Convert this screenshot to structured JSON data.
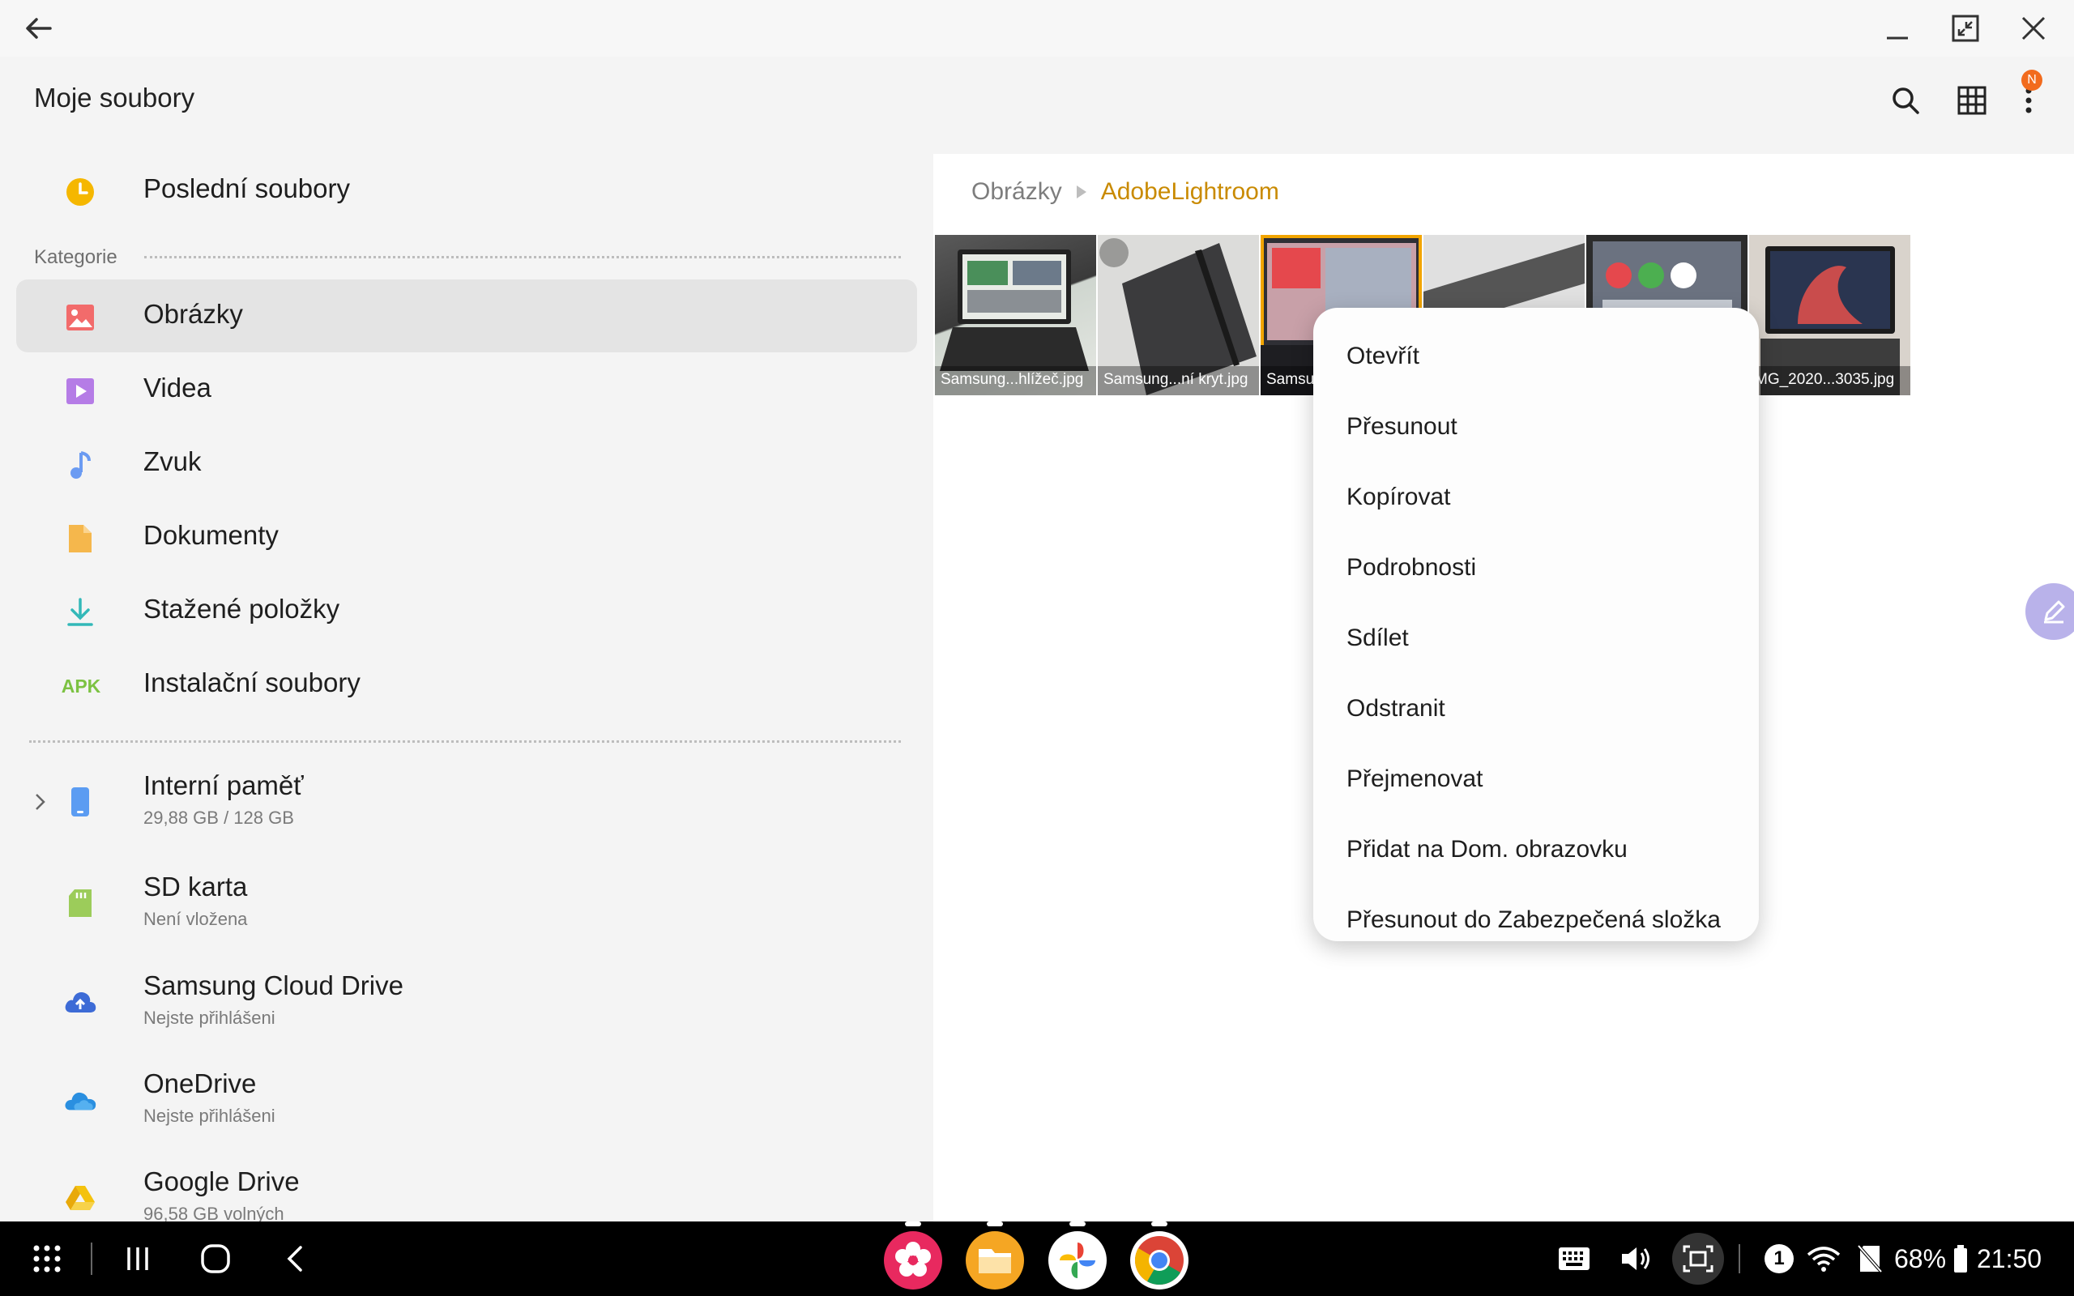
{
  "app": {
    "title": "Moje soubory",
    "notification_badge": "N"
  },
  "window_controls": {
    "back_icon": "arrow-left-icon",
    "minimize_icon": "minimize-icon",
    "restore_icon": "restore-icon",
    "close_icon": "close-icon"
  },
  "header_actions": {
    "search_icon": "search-icon",
    "view_icon": "grid-view-icon",
    "more_icon": "more-vert-icon"
  },
  "sidebar": {
    "recent": {
      "label": "Poslední soubory",
      "icon": "clock-icon",
      "color": "#f5b700"
    },
    "category_heading": "Kategorie",
    "categories": [
      {
        "label": "Obrázky",
        "icon": "image-icon",
        "color": "#f26b6b",
        "active": true
      },
      {
        "label": "Videa",
        "icon": "video-icon",
        "color": "#b57ce6"
      },
      {
        "label": "Zvuk",
        "icon": "music-icon",
        "color": "#6b9bf2"
      },
      {
        "label": "Dokumenty",
        "icon": "document-icon",
        "color": "#f5b74c"
      },
      {
        "label": "Stažené položky",
        "icon": "download-icon",
        "color": "#33b8b8"
      },
      {
        "label": "Instalační soubory",
        "icon": "apk-icon",
        "icon_text": "APK",
        "color": "#7cc242"
      }
    ],
    "storage": [
      {
        "label": "Interní paměť",
        "sub": "29,88 GB / 128 GB",
        "icon": "phone-icon",
        "color": "#5b9cf2",
        "expandable": true
      },
      {
        "label": "SD karta",
        "sub": "Není vložena",
        "icon": "sd-card-icon",
        "color": "#9ccc5a"
      },
      {
        "label": "Samsung Cloud Drive",
        "sub": "Nejste přihlášeni",
        "icon": "cloud-upload-icon",
        "color": "#3d6bd6"
      },
      {
        "label": "OneDrive",
        "sub": "Nejste přihlášeni",
        "icon": "onedrive-icon",
        "color": "#2a8fe0"
      },
      {
        "label": "Google Drive",
        "sub": "96,58 GB volných",
        "icon": "google-drive-icon",
        "color": "#f4c20d"
      }
    ]
  },
  "content": {
    "breadcrumb": {
      "parent": "Obrázky",
      "current": "AdobeLightroom"
    },
    "thumbnails": [
      {
        "caption": "Samsung...hlížeč.jpg",
        "bg1": "#3a3a3a",
        "bg2": "#cfd6cf"
      },
      {
        "caption": "Samsung...ní kryt.jpg",
        "bg1": "#3b3b3d",
        "bg2": "#d8d8d6"
      },
      {
        "caption": "Samsu",
        "bg1": "#2f2f35",
        "bg2": "#c8a0a8",
        "selected": true
      },
      {
        "caption": "",
        "bg1": "#555555",
        "bg2": "#e0e0e0"
      },
      {
        "caption": "",
        "bg1": "#2c2c2c",
        "bg2": "#6b7280"
      },
      {
        "caption": "MG_2020...3035.jpg",
        "bg1": "#3d3d3d",
        "bg2": "#c94c4c"
      }
    ]
  },
  "context_menu": {
    "items": [
      "Otevřít",
      "Přesunout",
      "Kopírovat",
      "Podrobnosti",
      "Sdílet",
      "Odstranit",
      "Přejmenovat",
      "Přidat na Dom. obrazovku",
      "Přesunout do Zabezpečená složka"
    ]
  },
  "floating": {
    "edit_icon": "pen-icon"
  },
  "taskbar": {
    "apps_icon": "app-drawer-icon",
    "recents_icon": "recents-icon",
    "home_icon": "home-icon",
    "back_icon": "back-icon",
    "pinned_apps": [
      {
        "name": "blossom-app-icon",
        "color": "#e8295f"
      },
      {
        "name": "my-files-app-icon",
        "color": "#f5a623"
      },
      {
        "name": "google-photos-app-icon",
        "color": "#ffffff"
      },
      {
        "name": "chrome-app-icon",
        "color": "#ffffff"
      }
    ],
    "status": {
      "keyboard_icon": "keyboard-icon",
      "volume_icon": "volume-icon",
      "screenshot_icon": "screenshot-icon",
      "notification_count": "1",
      "wifi_icon": "wifi-icon",
      "no_sim_icon": "no-sim-icon",
      "battery": "68%",
      "battery_icon": "battery-icon",
      "time": "21:50"
    }
  }
}
